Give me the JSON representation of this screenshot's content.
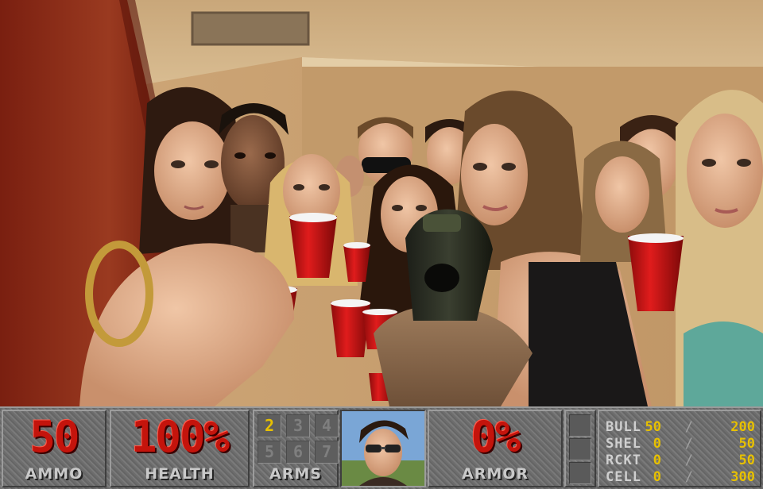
{
  "hud": {
    "ammo": {
      "value": "50",
      "label": "AMMO"
    },
    "health": {
      "value": "100%",
      "label": "HEALTH"
    },
    "arms": {
      "label": "ARMS",
      "slots": [
        {
          "number": "2",
          "owned": true
        },
        {
          "number": "3",
          "owned": false
        },
        {
          "number": "4",
          "owned": false
        },
        {
          "number": "5",
          "owned": false
        },
        {
          "number": "6",
          "owned": false
        },
        {
          "number": "7",
          "owned": false
        }
      ]
    },
    "armor": {
      "value": "0%",
      "label": "ARMOR"
    },
    "ammo_table": [
      {
        "type": "BULL",
        "current": "50",
        "max": "200"
      },
      {
        "type": "SHEL",
        "current": "0",
        "max": "50"
      },
      {
        "type": "RCKT",
        "current": "0",
        "max": "50"
      },
      {
        "type": "CELL",
        "current": "0",
        "max": "300"
      }
    ],
    "separator": "/"
  },
  "colors": {
    "hud_red": "#c4140c",
    "hud_yellow": "#e7c000",
    "hud_grey": "#6d6d6d"
  }
}
